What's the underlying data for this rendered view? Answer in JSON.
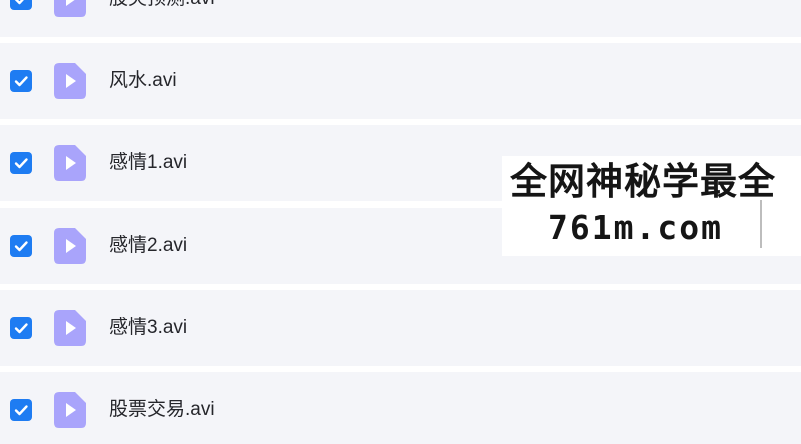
{
  "files": [
    {
      "name": "股灾预测.avi",
      "checked": true
    },
    {
      "name": "风水.avi",
      "checked": true
    },
    {
      "name": "感情1.avi",
      "checked": true
    },
    {
      "name": "感情2.avi",
      "checked": true
    },
    {
      "name": "感情3.avi",
      "checked": true
    },
    {
      "name": "股票交易.avi",
      "checked": true
    }
  ],
  "watermark": {
    "line1": "全网神秘学最全",
    "line2": "761m.com"
  },
  "colors": {
    "row_background": "#f4f5f9",
    "checkbox": "#1e7cf2",
    "video_icon": "#a9a4fb"
  },
  "icons": {
    "checkbox": "checkmark-icon",
    "file": "video-file-icon"
  }
}
